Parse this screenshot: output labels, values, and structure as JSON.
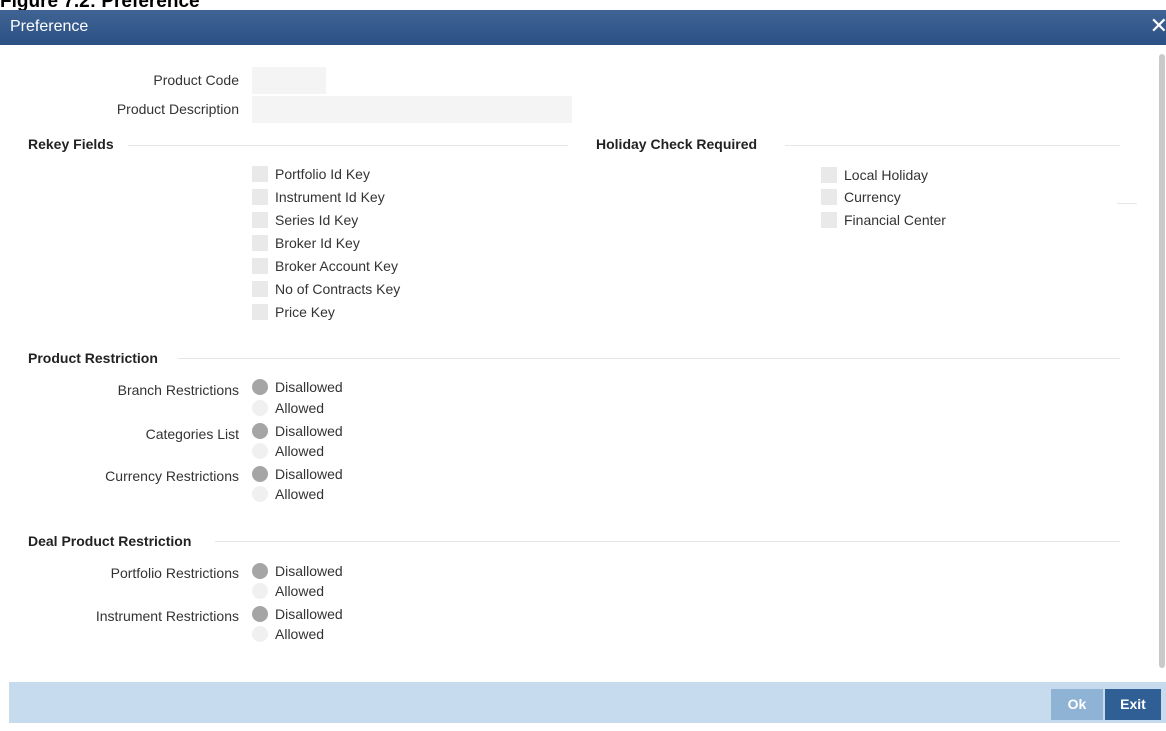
{
  "caption": "Figure 7.2: Preference",
  "window": {
    "title": "Preference",
    "close_glyph": "✕"
  },
  "fields": {
    "product_code": {
      "label": "Product Code",
      "value": ""
    },
    "product_description": {
      "label": "Product Description",
      "value": ""
    }
  },
  "rekey": {
    "title": "Rekey Fields",
    "items": [
      "Portfolio Id Key",
      "Instrument Id Key",
      "Series Id Key",
      "Broker Id Key",
      "Broker Account Key",
      "No of Contracts Key",
      "Price Key"
    ]
  },
  "holiday": {
    "title": "Holiday Check Required",
    "items": [
      "Local Holiday",
      "Currency",
      "Financial Center"
    ]
  },
  "product_restriction": {
    "title": "Product Restriction",
    "rows": [
      {
        "label": "Branch Restrictions",
        "options": [
          "Disallowed",
          "Allowed"
        ],
        "selected": "Disallowed"
      },
      {
        "label": "Categories List",
        "options": [
          "Disallowed",
          "Allowed"
        ],
        "selected": "Disallowed"
      },
      {
        "label": "Currency Restrictions",
        "options": [
          "Disallowed",
          "Allowed"
        ],
        "selected": "Disallowed"
      }
    ]
  },
  "deal_restriction": {
    "title": "Deal Product Restriction",
    "rows": [
      {
        "label": "Portfolio Restrictions",
        "options": [
          "Disallowed",
          "Allowed"
        ],
        "selected": "Disallowed"
      },
      {
        "label": "Instrument Restrictions",
        "options": [
          "Disallowed",
          "Allowed"
        ],
        "selected": "Disallowed"
      }
    ]
  },
  "footer": {
    "ok_label": "Ok",
    "exit_label": "Exit"
  },
  "colors": {
    "titlebar": "#2f5488",
    "footer": "#c6dbed",
    "exit_button": "#305f95",
    "ok_button": "#8fb3d4"
  }
}
